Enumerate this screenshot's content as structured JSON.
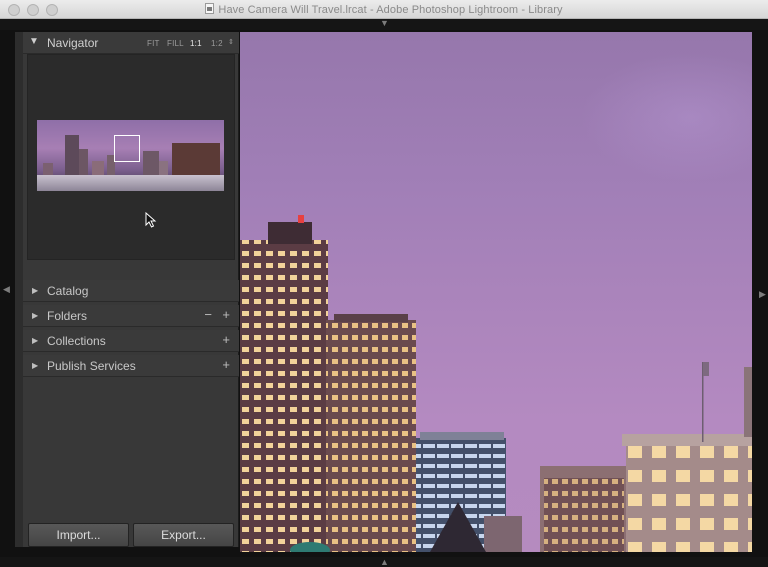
{
  "window": {
    "title": "Have Camera Will Travel.lrcat - Adobe Photoshop Lightroom - Library"
  },
  "navigator": {
    "title": "Navigator",
    "zoom_options": [
      "FIT",
      "FILL",
      "1:1",
      "1:2"
    ],
    "active_zoom": "1:1"
  },
  "panels": [
    {
      "label": "Catalog",
      "minus": "",
      "plus": ""
    },
    {
      "label": "Folders",
      "minus": "−",
      "plus": "+"
    },
    {
      "label": "Collections",
      "minus": "",
      "plus": "+"
    },
    {
      "label": "Publish Services",
      "minus": "",
      "plus": "+"
    }
  ],
  "buttons": {
    "import": "Import...",
    "export": "Export..."
  },
  "icons": {
    "panel_expand": "triangle-right-icon",
    "panel_collapse": "triangle-down-icon",
    "cursor": "arrow-cursor-icon"
  },
  "colors": {
    "sky": "#a17fb7",
    "panel_bg": "#383838"
  }
}
